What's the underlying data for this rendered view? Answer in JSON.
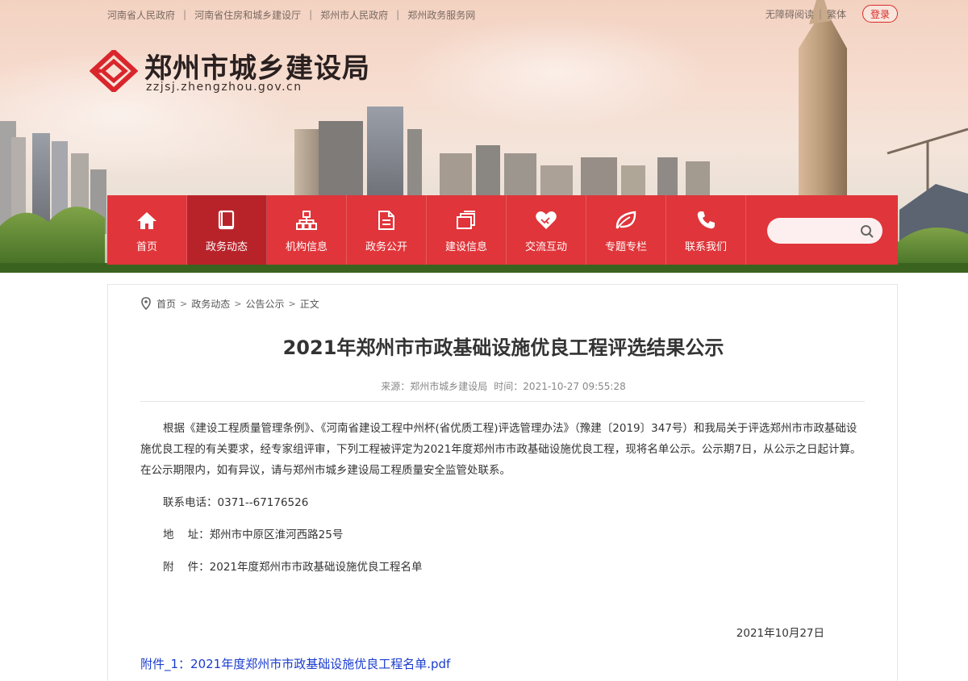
{
  "top_links": [
    "河南省人民政府",
    "河南省住房和城乡建设厅",
    "郑州市人民政府",
    "郑州政务服务网"
  ],
  "accessibility": {
    "barrier_free": "无障碍阅读",
    "traditional": "繁体",
    "login": "登录"
  },
  "logo": {
    "title": "郑州市城乡建设局",
    "domain": "zzjsj.zhengzhou.gov.cn"
  },
  "nav": {
    "items": [
      {
        "label": "首页",
        "icon": "home-icon"
      },
      {
        "label": "政务动态",
        "icon": "book-icon",
        "active": true
      },
      {
        "label": "机构信息",
        "icon": "org-chart-icon"
      },
      {
        "label": "政务公开",
        "icon": "document-icon"
      },
      {
        "label": "建设信息",
        "icon": "stack-icon"
      },
      {
        "label": "交流互动",
        "icon": "handshake-heart-icon"
      },
      {
        "label": "专题专栏",
        "icon": "leaf-icon"
      },
      {
        "label": "联系我们",
        "icon": "phone-icon"
      }
    ],
    "search_placeholder": ""
  },
  "breadcrumb": [
    "首页",
    "政务动态",
    "公告公示",
    "正文"
  ],
  "article": {
    "title": "2021年郑州市市政基础设施优良工程评选结果公示",
    "source_label": "来源：",
    "source": "郑州市城乡建设局",
    "time_label": "时间：",
    "time": "2021-10-27 09:55:28",
    "body": "根据《建设工程质量管理条例》、《河南省建设工程中州杯(省优质工程)评选管理办法》（豫建〔2019〕347号）和我局关于评选郑州市市政基础设施优良工程的有关要求，经专家组评审，下列工程被评定为2021年度郑州市市政基础设施优良工程，现将名单公示。公示期7日，从公示之日起计算。在公示期限内，如有异议，请与郑州市城乡建设局工程质量安全监管处联系。",
    "phone_line": "联系电话：0371--67176526",
    "address_line": "地    址：郑州市中原区淮河西路25号",
    "attachment_line": "附    件：2021年度郑州市市政基础设施优良工程名单",
    "date": "2021年10月27日",
    "attachment_link": "附件_1：2021年度郑州市市政基础设施优良工程名单.pdf"
  },
  "colors": {
    "brand_red": "#e0353a",
    "active_red": "#b8232a",
    "link_blue": "#1a3ccf"
  }
}
